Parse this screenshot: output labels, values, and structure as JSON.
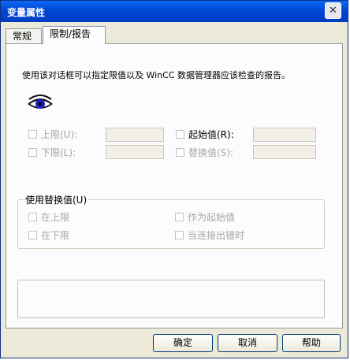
{
  "window": {
    "title": "变量属性",
    "close_symbol": "✕"
  },
  "tabs": [
    {
      "label": "常规"
    },
    {
      "label": "限制/报告"
    }
  ],
  "description": "使用该对话框可以指定限值以及 WinCC 数据管理器应该检查的报告。",
  "icons": {
    "eye": "eye-icon"
  },
  "limits": {
    "upper": {
      "label": "上限(U):",
      "value": ""
    },
    "lower": {
      "label": "下限(L):",
      "value": ""
    },
    "start_value": {
      "label": "起始值(R):",
      "value": ""
    },
    "substitute": {
      "label": "替换值(S):",
      "value": ""
    }
  },
  "group": {
    "title": "使用替换值(U)",
    "options": {
      "at_upper": "在上限",
      "at_lower": "在下限",
      "as_start": "作为起始值",
      "on_conn_error": "当连接出错时"
    }
  },
  "buttons": {
    "ok": "确定",
    "cancel": "取消",
    "help": "帮助"
  },
  "colors": {
    "title_bar": "#0054e3",
    "dialog_bg": "#ece9d8",
    "panel_bg": "#fcfcfe",
    "disabled_text": "#a5a5a5"
  }
}
